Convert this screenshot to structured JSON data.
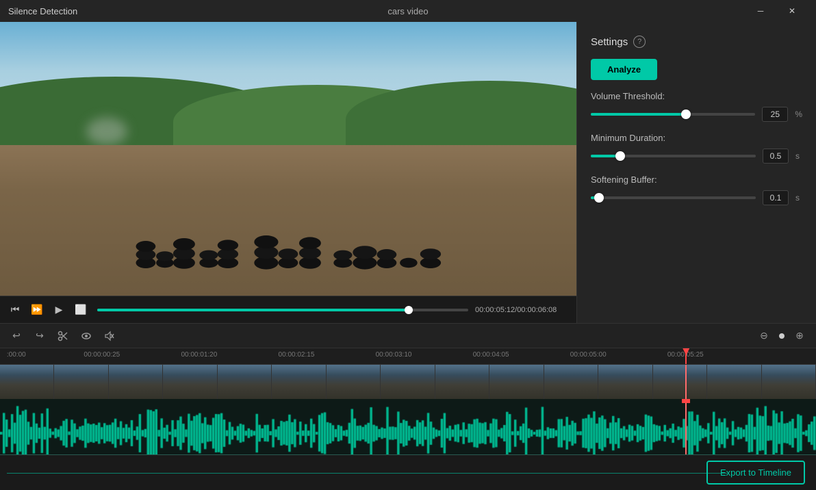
{
  "titlebar": {
    "app_title": "Silence Detection",
    "file_name": "cars video",
    "minimize_label": "─",
    "close_label": "✕"
  },
  "settings": {
    "title": "Settings",
    "help_icon": "?",
    "analyze_label": "Analyze",
    "volume_threshold": {
      "label": "Volume Threshold:",
      "value": "25",
      "unit": "%",
      "fill_pct": 58
    },
    "minimum_duration": {
      "label": "Minimum Duration:",
      "value": "0.5",
      "unit": "s",
      "fill_pct": 18
    },
    "softening_buffer": {
      "label": "Softening Buffer:",
      "value": "0.1",
      "unit": "s",
      "fill_pct": 5
    }
  },
  "video_controls": {
    "time_current": "00:00:05:12",
    "time_total": "00:00:06:08",
    "progress_pct": 84
  },
  "timeline": {
    "toolbar": {
      "undo_label": "↩",
      "redo_label": "↪",
      "cut_label": "✂",
      "eye_label": "👁",
      "mute_label": "🔇",
      "zoom_minus": "⊖",
      "zoom_plus": "⊕"
    },
    "ruler_marks": [
      {
        "label": ":00:00",
        "pct": 0.5
      },
      {
        "label": "00:00:00:25",
        "pct": 10
      },
      {
        "label": "00:00:01:20",
        "pct": 22
      },
      {
        "label": "00:00:02:15",
        "pct": 34
      },
      {
        "label": "00:00:03:10",
        "pct": 46
      },
      {
        "label": "00:00:04:05",
        "pct": 58
      },
      {
        "label": "00:00:05:00",
        "pct": 70
      },
      {
        "label": "00:00:05:25",
        "pct": 82
      }
    ],
    "playhead_pct": 84
  },
  "export": {
    "button_label": "Export to Timeline"
  }
}
